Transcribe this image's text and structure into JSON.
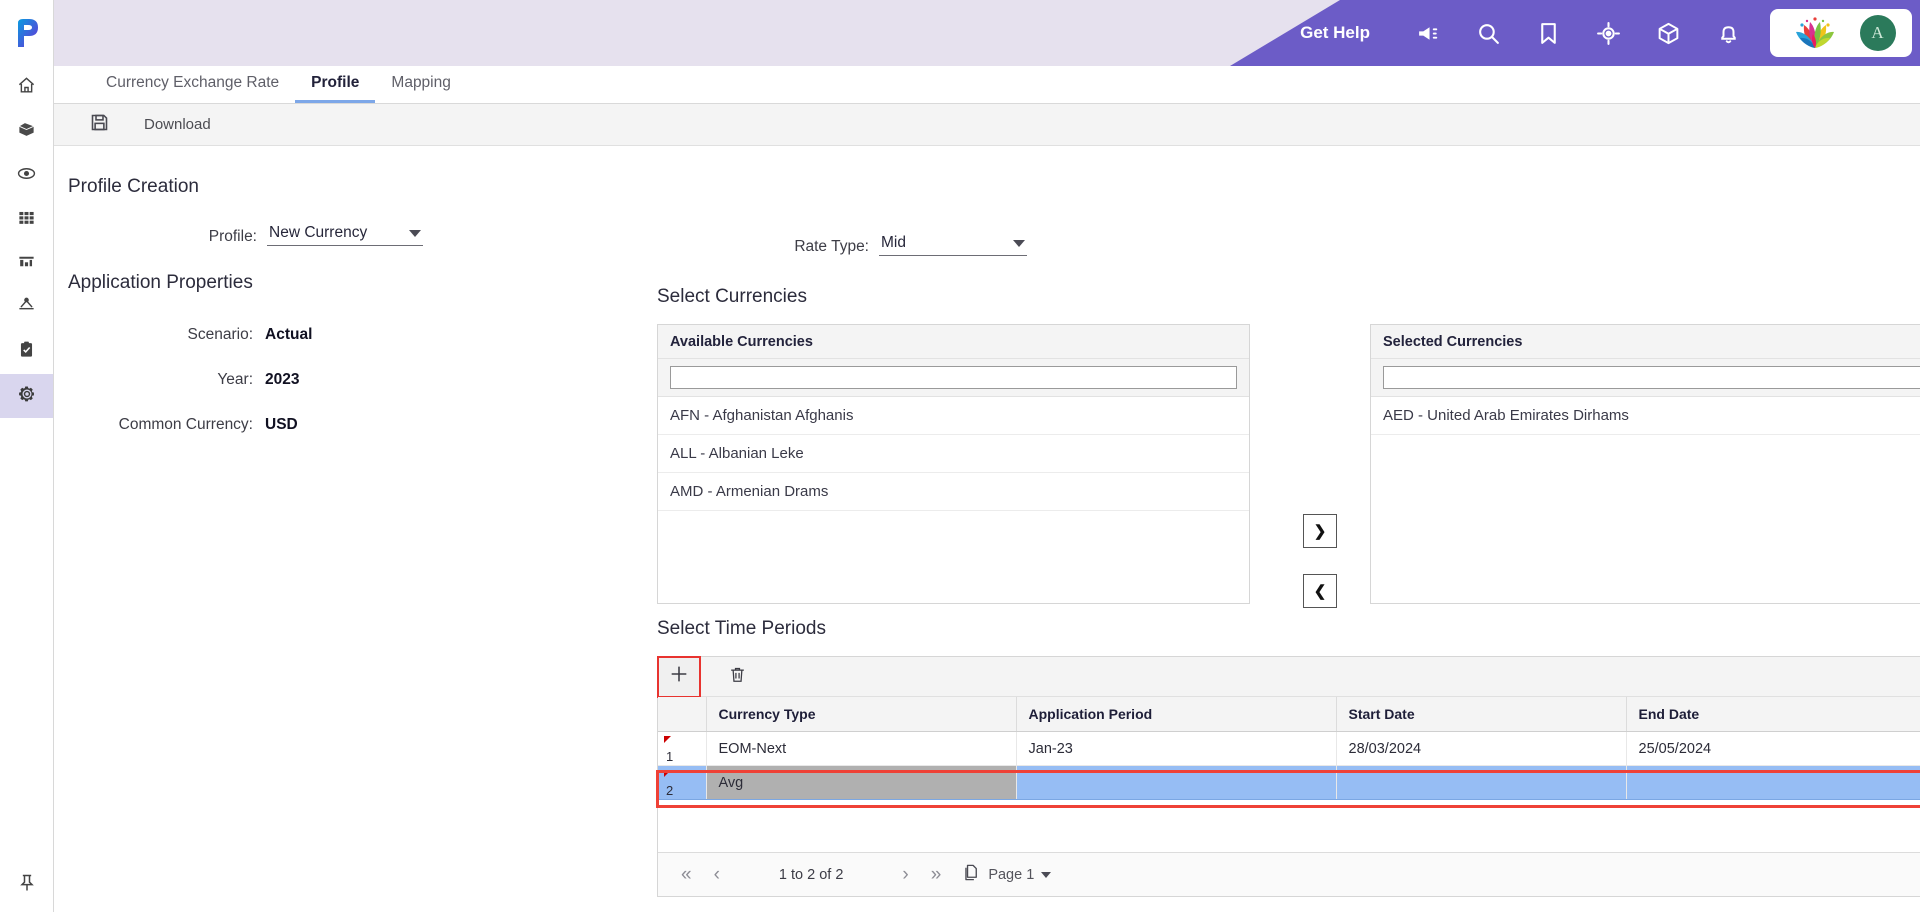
{
  "header": {
    "get_help": "Get Help",
    "icons": [
      "megaphone-icon",
      "search-icon",
      "bookmark-icon",
      "target-icon",
      "cube-icon",
      "bell-icon"
    ],
    "avatar_initial": "A",
    "purple": "#6c5cc7"
  },
  "rail": {
    "logo": "p-logo",
    "items": [
      {
        "icon": "home-icon",
        "active": false
      },
      {
        "icon": "cube-icon",
        "active": false
      },
      {
        "icon": "eye-icon",
        "active": false
      },
      {
        "icon": "grid-icon",
        "active": false
      },
      {
        "icon": "bar-chart-icon",
        "active": false
      },
      {
        "icon": "hierarchy-icon",
        "active": false
      },
      {
        "icon": "clipboard-check-icon",
        "active": false
      },
      {
        "icon": "gear-icon",
        "active": true
      }
    ],
    "pin": "pin-icon"
  },
  "tabs": [
    {
      "label": "Currency Exchange Rate",
      "active": false
    },
    {
      "label": "Profile",
      "active": true
    },
    {
      "label": "Mapping",
      "active": false
    }
  ],
  "toolbar": {
    "save_icon": "floppy-disk-icon",
    "download_label": "Download"
  },
  "profile_creation": {
    "title": "Profile Creation",
    "profile_label": "Profile:",
    "profile_value": "New Currency"
  },
  "application_properties": {
    "title": "Application Properties",
    "rows": [
      {
        "label": "Scenario:",
        "value": "Actual"
      },
      {
        "label": "Year:",
        "value": "2023"
      },
      {
        "label": "Common Currency:",
        "value": "USD"
      }
    ]
  },
  "rate_type": {
    "label": "Rate Type:",
    "value": "Mid"
  },
  "select_currencies": {
    "title": "Select Currencies",
    "available": {
      "header": "Available Currencies",
      "search_value": "",
      "search_placeholder": "",
      "items": [
        "AFN - Afghanistan Afghanis",
        "ALL - Albanian Leke",
        "AMD - Armenian Drams"
      ]
    },
    "selected": {
      "header": "Selected Currencies",
      "search_value": "",
      "search_placeholder": "",
      "items": [
        "AED - United Arab Emirates Dirhams"
      ]
    },
    "move_right": "❯",
    "move_left": "❮"
  },
  "select_time_periods": {
    "title": "Select Time Periods",
    "add_icon": "plus-icon",
    "delete_icon": "trash-icon",
    "sort_icon": "arrow-up-icon",
    "columns": [
      "",
      "Currency Type",
      "Application Period",
      "Start Date",
      "End Date"
    ],
    "rows": [
      {
        "num": "1",
        "currency_type": "EOM-Next",
        "application_period": "Jan-23",
        "start_date": "28/03/2024",
        "end_date": "25/05/2024",
        "selected": false
      },
      {
        "num": "2",
        "currency_type": "Avg",
        "application_period": "",
        "start_date": "",
        "end_date": "",
        "selected": true
      }
    ],
    "footer": {
      "first": "«",
      "prev": "‹",
      "count": "1 to 2 of 2",
      "next": "›",
      "last": "»",
      "page_icon": "pages-icon",
      "page_label": "Page 1"
    }
  }
}
